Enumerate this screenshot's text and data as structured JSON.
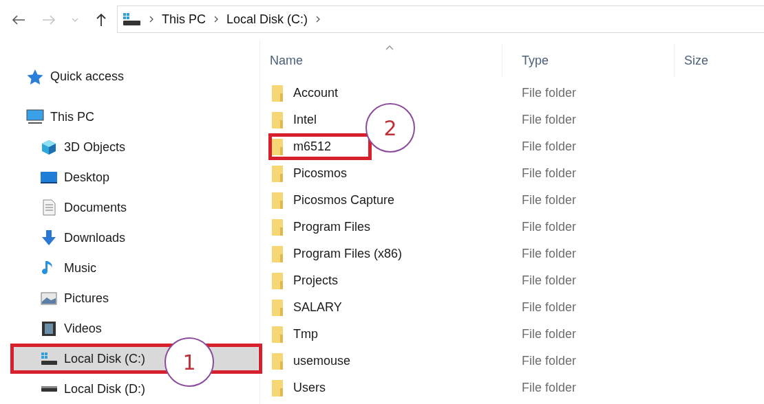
{
  "navigation": {
    "back": {
      "disabled": false
    },
    "forward": {
      "disabled": true
    }
  },
  "address_bar": {
    "segments": [
      "This PC",
      "Local Disk (C:)"
    ]
  },
  "nav_pane": {
    "items": [
      {
        "label": "Quick access",
        "kind": "quick-access",
        "selected": false
      },
      {
        "label": "This PC",
        "kind": "pc",
        "selected": false,
        "children": [
          {
            "label": "3D Objects",
            "kind": "objects",
            "selected": false
          },
          {
            "label": "Desktop",
            "kind": "desktop",
            "selected": false
          },
          {
            "label": "Documents",
            "kind": "documents",
            "selected": false
          },
          {
            "label": "Downloads",
            "kind": "downloads",
            "selected": false
          },
          {
            "label": "Music",
            "kind": "music",
            "selected": false
          },
          {
            "label": "Pictures",
            "kind": "pictures",
            "selected": false
          },
          {
            "label": "Videos",
            "kind": "videos",
            "selected": false
          },
          {
            "label": "Local Disk (C:)",
            "kind": "system-drive",
            "selected": true,
            "callout": "1"
          },
          {
            "label": "Local Disk (D:)",
            "kind": "drive",
            "selected": false
          }
        ]
      }
    ]
  },
  "file_list": {
    "columns": [
      {
        "label": "Name",
        "sorted": true
      },
      {
        "label": "Type",
        "sorted": false
      },
      {
        "label": "Size",
        "sorted": false
      }
    ],
    "rows": [
      {
        "name": "Account",
        "type": "File folder"
      },
      {
        "name": "Intel",
        "type": "File folder"
      },
      {
        "name": "m6512",
        "type": "File folder",
        "callout": "2"
      },
      {
        "name": "Picosmos",
        "type": "File folder"
      },
      {
        "name": "Picosmos Capture",
        "type": "File folder"
      },
      {
        "name": "Program Files",
        "type": "File folder"
      },
      {
        "name": "Program Files (x86)",
        "type": "File folder"
      },
      {
        "name": "Projects",
        "type": "File folder"
      },
      {
        "name": "SALARY",
        "type": "File folder"
      },
      {
        "name": "Tmp",
        "type": "File folder"
      },
      {
        "name": "usemouse",
        "type": "File folder"
      },
      {
        "name": "Users",
        "type": "File folder"
      }
    ]
  }
}
